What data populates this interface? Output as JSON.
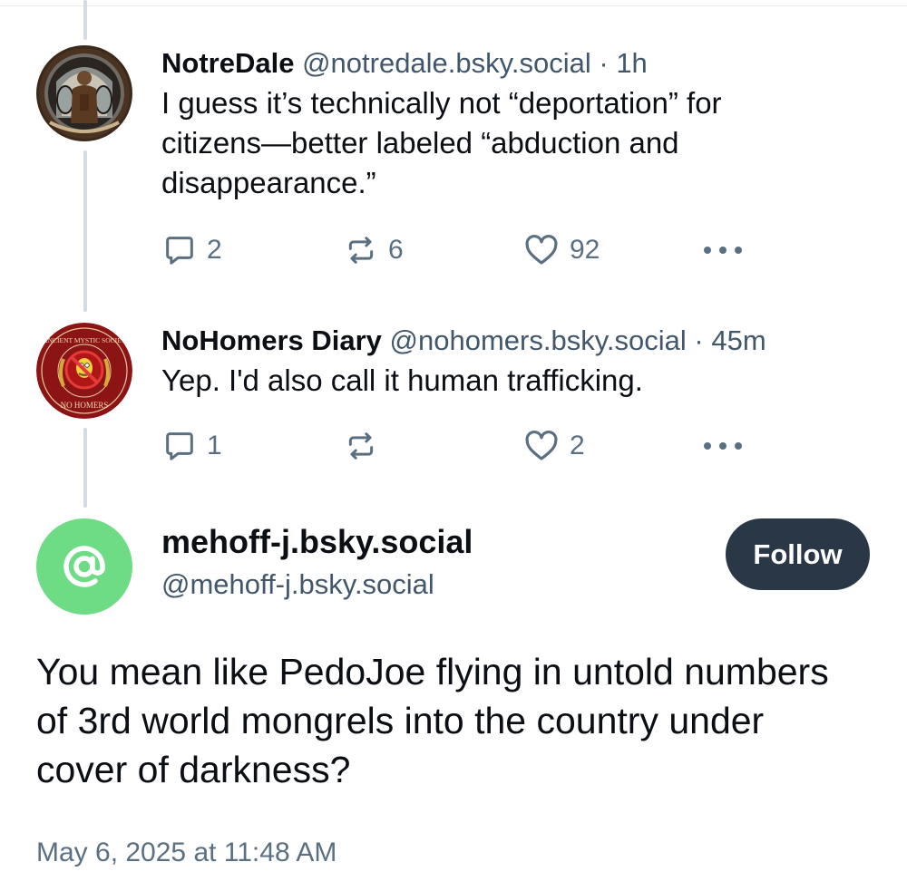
{
  "posts": [
    {
      "display_name": "NotreDale",
      "handle": "@notredale.bsky.social",
      "separator": "·",
      "time": "1h",
      "text": "I guess it’s technically not “deportation” for citizens—better labeled “abduction and disappearance.”",
      "replies": "2",
      "reposts": "6",
      "likes": "92",
      "avatar": "stained-glass-monk-avatar"
    },
    {
      "display_name": "NoHomers Diary",
      "handle": "@nohomers.bsky.social",
      "separator": "·",
      "time": "45m",
      "text": "Yep. I'd also call it human trafficking.",
      "replies": "1",
      "reposts": "",
      "likes": "2",
      "avatar": "no-homers-seal-avatar",
      "avatar_text_top": "THE ANCIENT MYSTIC SOCIETY OF",
      "avatar_text_bottom": "NO HOMERS"
    }
  ],
  "main_post": {
    "display_name": "mehoff-j.bsky.social",
    "handle": "@mehoff-j.bsky.social",
    "follow_label": "Follow",
    "text": "You mean like PedoJoe flying in untold numbers of 3rd world mongrels into the country under cover of darkness?",
    "timestamp": "May 6, 2025 at 11:48 AM",
    "avatar_symbol": "@"
  },
  "colors": {
    "thread_line": "#d4dbe2",
    "muted_text": "#42576c",
    "icon": "#5b6f83",
    "follow_button": "#293747",
    "default_avatar": "#6ddc84"
  },
  "icons": [
    "reply-icon",
    "repost-icon",
    "like-icon",
    "more-icon"
  ]
}
